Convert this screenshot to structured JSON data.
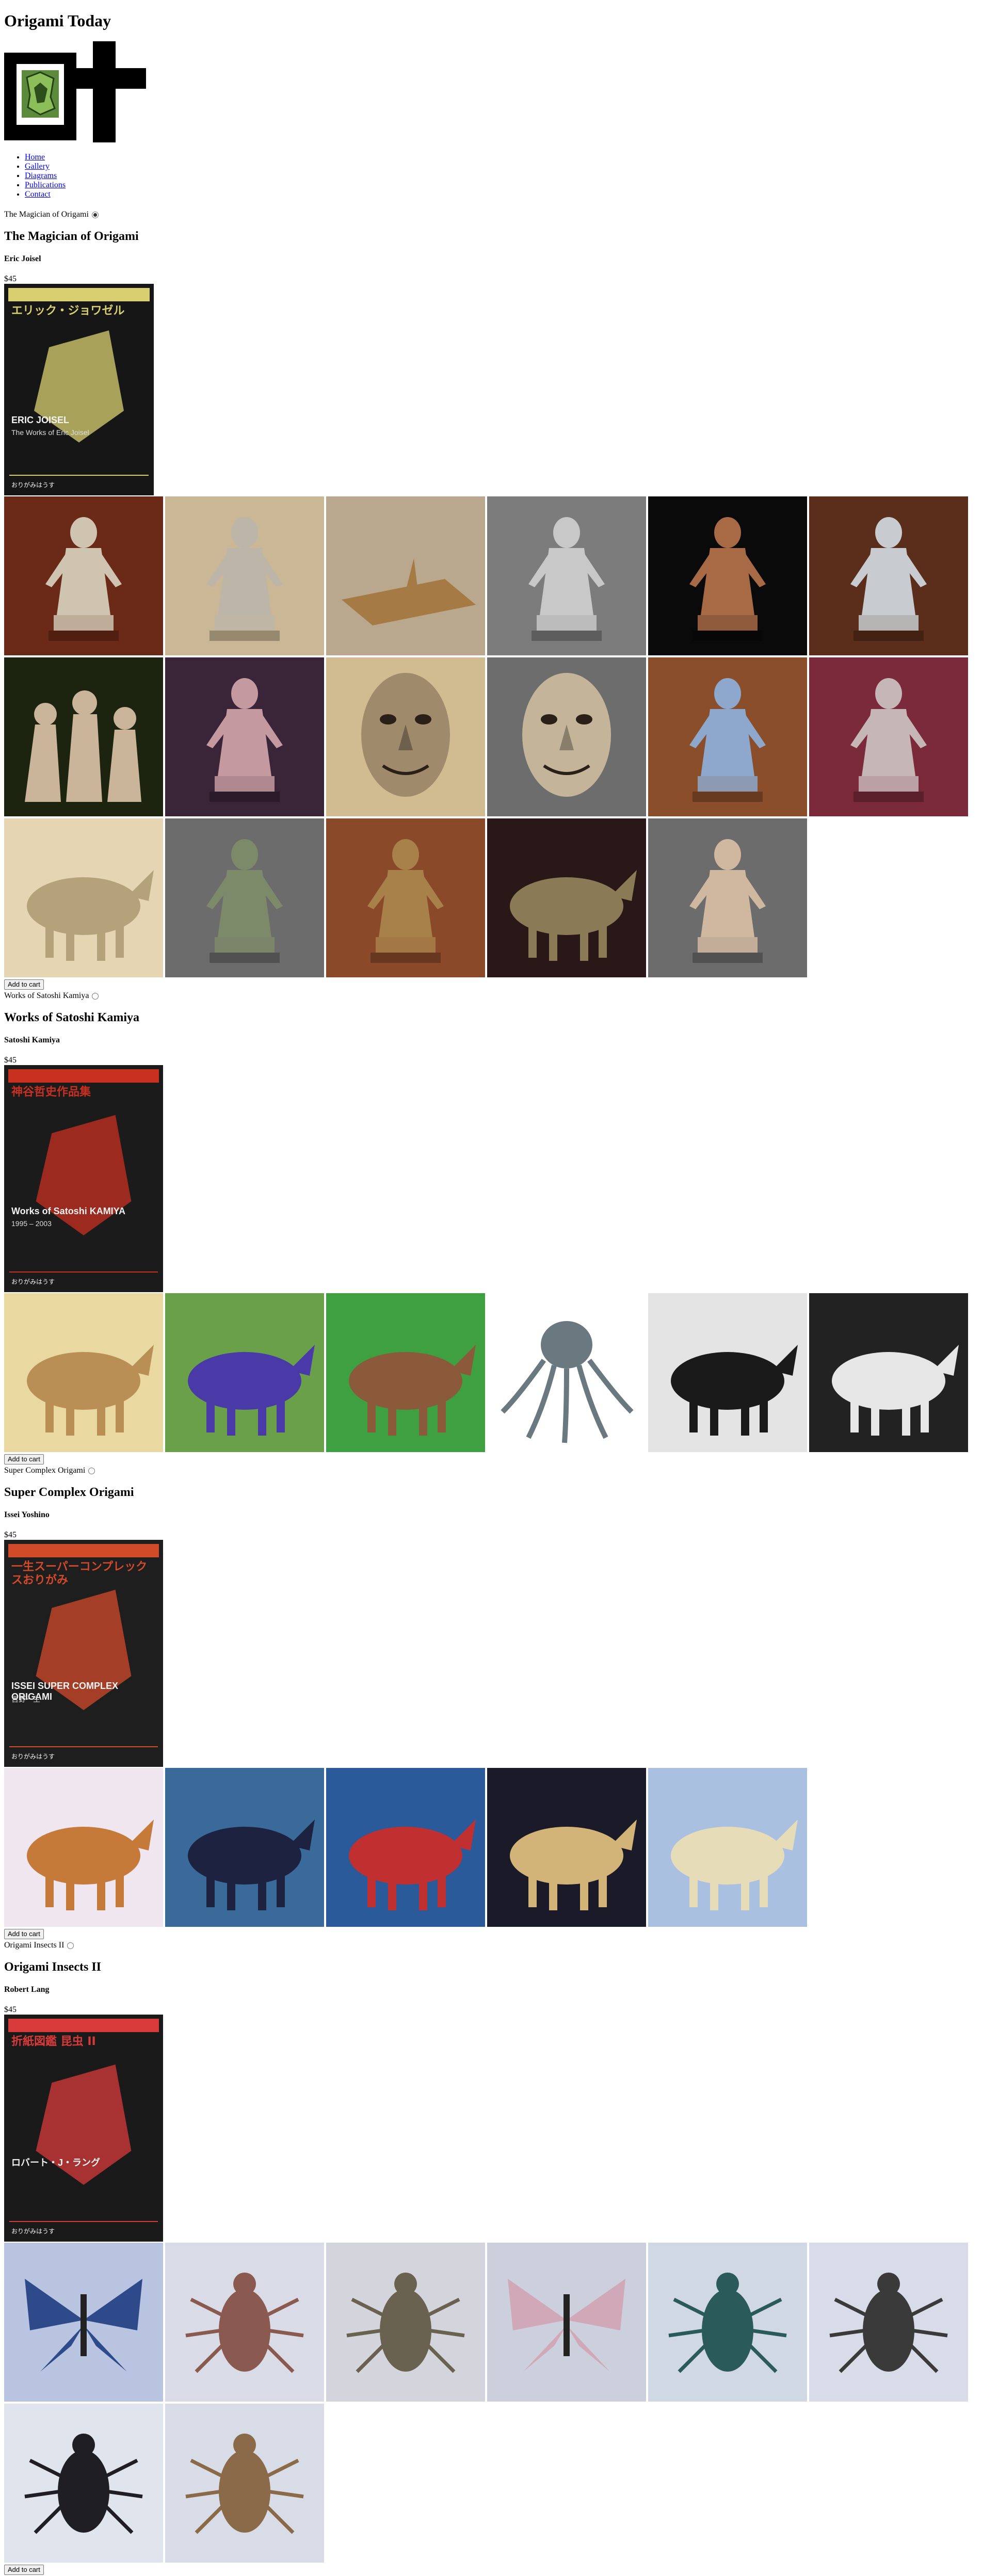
{
  "site": {
    "title": "Origami Today"
  },
  "nav": [
    "Home",
    "Gallery",
    "Diagrams",
    "Publications",
    "Contact"
  ],
  "colors": {
    "link": "#0000ee",
    "logo": "#000000",
    "logo_accent": "#5a8a3a"
  },
  "books": [
    {
      "selector_label": "The Magician of Origami",
      "selected": true,
      "title": "The Magician of Origami",
      "author": "Eric Joisel",
      "price": "$45",
      "cover": {
        "bg": "#161616",
        "accent": "#d8d070",
        "jp_title": "エリック・ジョワゼル",
        "en_title": "ERIC JOISEL",
        "sub": "The Works of Eric Joisel",
        "publisher": "おりがみはうす"
      },
      "add_label": "Add to cart",
      "gallery": [
        {
          "bg": "#6b2a18",
          "fig": "#cfc4b0",
          "kind": "figure"
        },
        {
          "bg": "#c9b796",
          "fig": "#bdb6a8",
          "kind": "figure"
        },
        {
          "bg": "#b9a88e",
          "fig": "#a67a45",
          "kind": "flat"
        },
        {
          "bg": "#7c7c7c",
          "fig": "#c8c8c8",
          "kind": "figure"
        },
        {
          "bg": "#0a0a0a",
          "fig": "#a86a45",
          "kind": "figure"
        },
        {
          "bg": "#5a2e1a",
          "fig": "#c8ccd0",
          "kind": "figure"
        },
        {
          "bg": "#1c2410",
          "fig": "#cbb59a",
          "kind": "group"
        },
        {
          "bg": "#3a2438",
          "fig": "#c49aa0",
          "kind": "figure"
        },
        {
          "bg": "#d1bc92",
          "fig": "#a08a6c",
          "kind": "face"
        },
        {
          "bg": "#6d6d6d",
          "fig": "#c4b49a",
          "kind": "face"
        },
        {
          "bg": "#8b4e2a",
          "fig": "#8da8cc",
          "kind": "figure"
        },
        {
          "bg": "#7a2a3a",
          "fig": "#c7b6b6",
          "kind": "figure"
        },
        {
          "bg": "#e5d5b2",
          "fig": "#b3a27a",
          "kind": "animal"
        },
        {
          "bg": "#6c6c6c",
          "fig": "#7d8a6a",
          "kind": "figure"
        },
        {
          "bg": "#8a4a2a",
          "fig": "#a8804a",
          "kind": "figure"
        },
        {
          "bg": "#2a1818",
          "fig": "#8a7a55",
          "kind": "animal"
        },
        {
          "bg": "#6c6c6c",
          "fig": "#d0b8a0",
          "kind": "figure"
        }
      ]
    },
    {
      "selector_label": "Works of Satoshi Kamiya",
      "selected": false,
      "title": "Works of Satoshi Kamiya",
      "author": "Satoshi Kamiya",
      "price": "$45",
      "cover": {
        "bg": "#1b1b1b",
        "accent": "#c83020",
        "jp_title": "神谷哲史作品集",
        "en_title": "Works of Satoshi KAMIYA",
        "sub": "1995 – 2003",
        "publisher": "おりがみはうす"
      },
      "add_label": "Add to cart",
      "gallery": [
        {
          "bg": "#e9d9a0",
          "fig": "#b98f55",
          "kind": "animal"
        },
        {
          "bg": "#6aa04a",
          "fig": "#4a3aa8",
          "kind": "animal"
        },
        {
          "bg": "#3ea040",
          "fig": "#8a5a3a",
          "kind": "animal"
        },
        {
          "bg": "#ffffff",
          "fig": "#6a7880",
          "kind": "octopus"
        },
        {
          "bg": "#e4e4e4",
          "fig": "#1a1a1a",
          "kind": "animal"
        },
        {
          "bg": "#222222",
          "fig": "#e6e6e6",
          "kind": "animal"
        }
      ]
    },
    {
      "selector_label": "Super Complex Origami",
      "selected": false,
      "title": "Super Complex Origami",
      "author": "Issei Yoshino",
      "price": "$45",
      "cover": {
        "bg": "#1e1e1e",
        "accent": "#d14a2a",
        "jp_title": "一生スーパーコンプレックスおりがみ",
        "en_title": "ISSEI SUPER COMPLEX ORIGAMI",
        "sub": "吉野一生",
        "publisher": "おりがみはうす"
      },
      "add_label": "Add to cart",
      "gallery": [
        {
          "bg": "#f0e6f0",
          "fig": "#c67a3a",
          "kind": "animal"
        },
        {
          "bg": "#3a6a9a",
          "fig": "#1c2240",
          "kind": "animal"
        },
        {
          "bg": "#2a5a9a",
          "fig": "#c03030",
          "kind": "animal"
        },
        {
          "bg": "#1a1a28",
          "fig": "#d2b478",
          "kind": "animal"
        },
        {
          "bg": "#aac0e0",
          "fig": "#e6dcb8",
          "kind": "animal"
        }
      ]
    },
    {
      "selector_label": "Origami Insects II",
      "selected": false,
      "title": "Origami Insects II",
      "author": "Robert Lang",
      "price": "$45",
      "cover": {
        "bg": "#1a1a1a",
        "accent": "#d83a3a",
        "jp_title": "折紙図鑑 昆虫 II",
        "en_title": "ロバート・J・ラング",
        "sub": "",
        "publisher": "おりがみはうす"
      },
      "add_label": "Add to cart",
      "gallery": [
        {
          "bg": "#b8c4e0",
          "fig": "#2e4a8a",
          "kind": "butterfly"
        },
        {
          "bg": "#d9dbe6",
          "fig": "#8a5a50",
          "kind": "insect"
        },
        {
          "bg": "#d4d4dc",
          "fig": "#6a6250",
          "kind": "insect"
        },
        {
          "bg": "#ccd0dc",
          "fig": "#d0a8b8",
          "kind": "butterfly"
        },
        {
          "bg": "#d0d8e4",
          "fig": "#2a5a5a",
          "kind": "insect"
        },
        {
          "bg": "#d8dce8",
          "fig": "#3a3a3a",
          "kind": "insect"
        },
        {
          "bg": "#e0e4ec",
          "fig": "#1e1e24",
          "kind": "insect"
        },
        {
          "bg": "#d8dce6",
          "fig": "#8a6a48",
          "kind": "insect"
        }
      ]
    }
  ]
}
